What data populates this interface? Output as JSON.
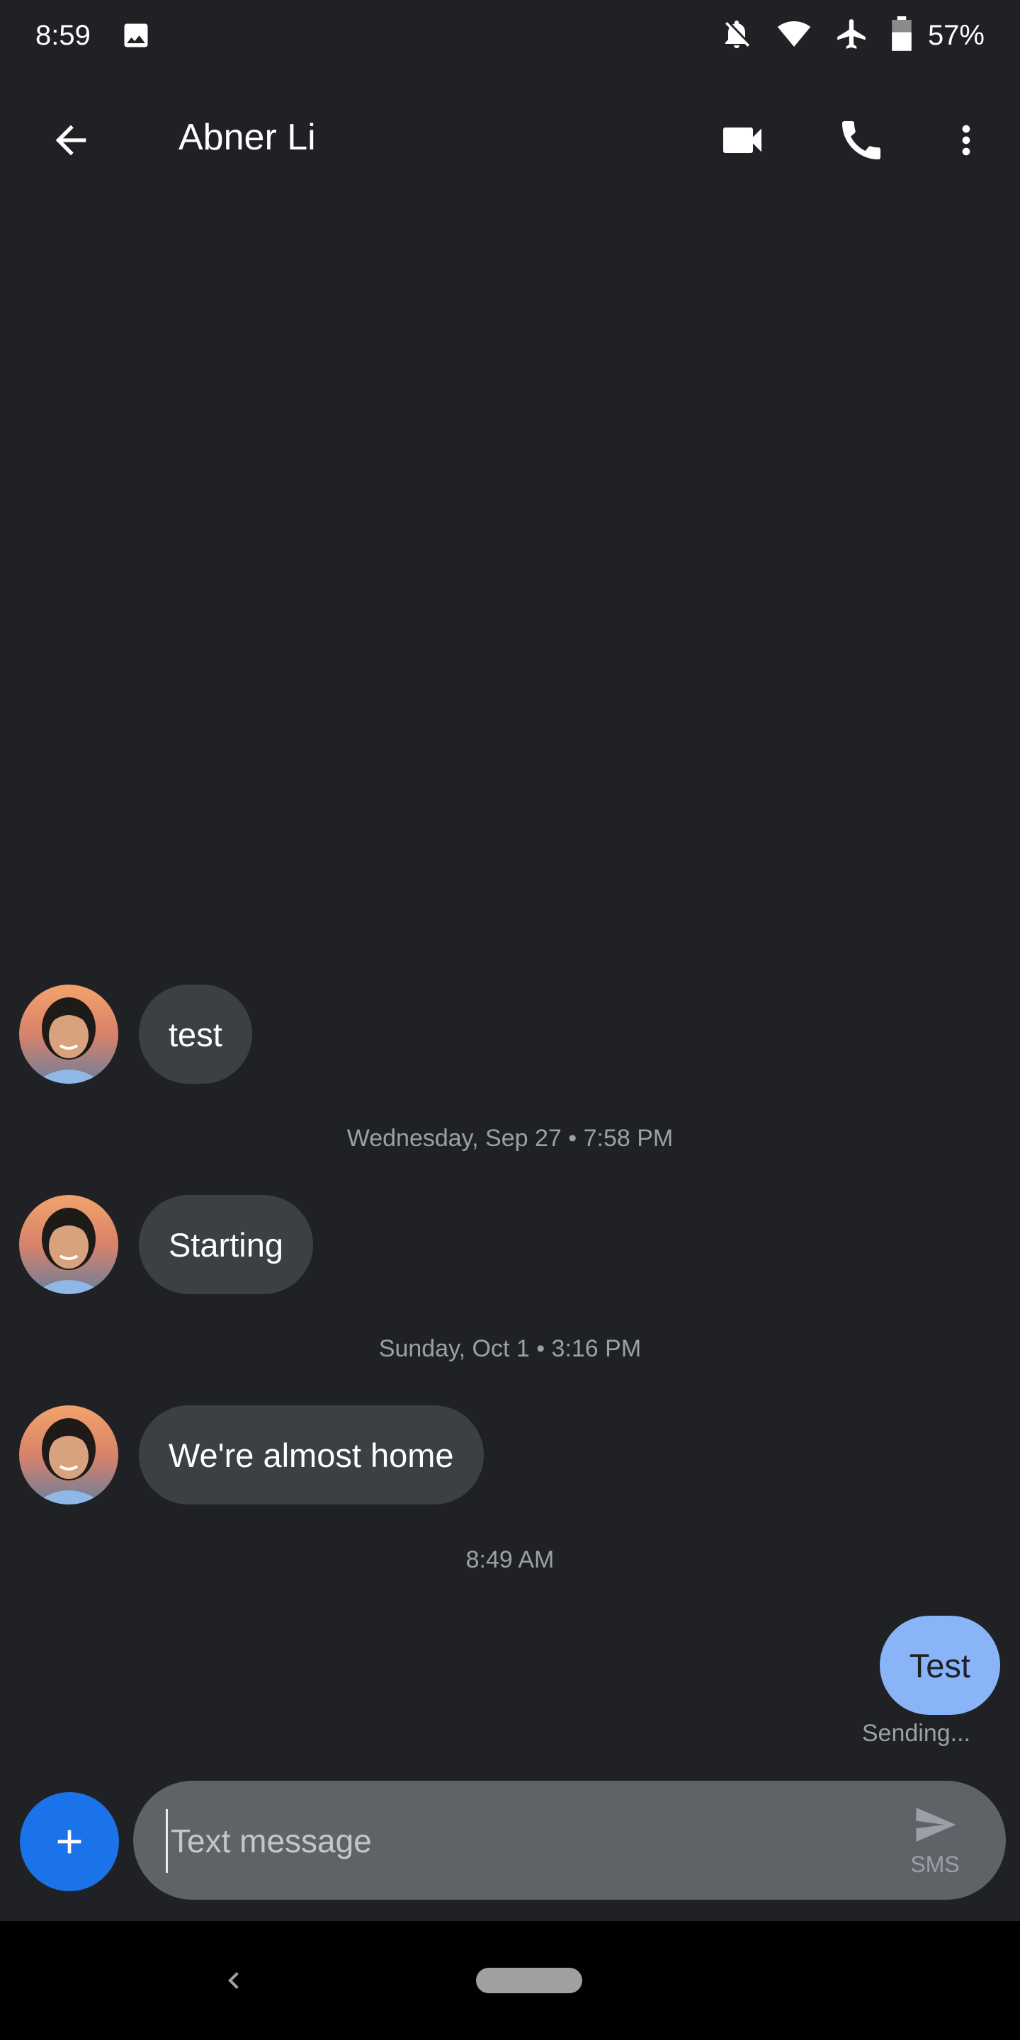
{
  "status_bar": {
    "time": "8:59",
    "battery_pct": "57%",
    "icons": [
      "image-icon",
      "notifications-off-icon",
      "wifi-icon",
      "airplane-icon",
      "battery-icon"
    ]
  },
  "app_bar": {
    "contact_name": "Abner Li",
    "icons": [
      "back-arrow-icon",
      "video-call-icon",
      "phone-icon",
      "more-vert-icon"
    ]
  },
  "messages": [
    {
      "type": "incoming",
      "text": "test"
    },
    {
      "type": "timestamp",
      "text": "Wednesday, Sep 27 • 7:58 PM"
    },
    {
      "type": "incoming",
      "text": "Starting"
    },
    {
      "type": "timestamp",
      "text": "Sunday, Oct 1 • 3:16 PM"
    },
    {
      "type": "incoming",
      "text": "We're almost home"
    },
    {
      "type": "timestamp",
      "text": "8:49 AM"
    },
    {
      "type": "outgoing",
      "text": "Test",
      "status": "Sending..."
    }
  ],
  "compose": {
    "placeholder": "Text message",
    "send_label": "SMS"
  },
  "colors": {
    "background": "#202124",
    "incoming_bubble": "#3c4043",
    "outgoing_bubble": "#8ab4f8",
    "accent": "#1a73e8",
    "compose_bg": "#5f6368"
  }
}
